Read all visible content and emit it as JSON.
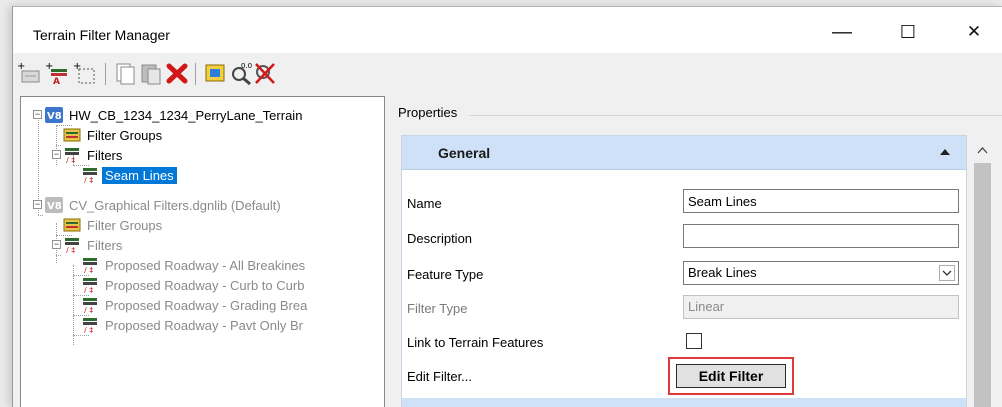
{
  "window": {
    "title": "Terrain Filter Manager"
  },
  "controls": {
    "minimize": "—",
    "maximize": "☐",
    "close": "✕"
  },
  "toolbar": {
    "buttons": [
      "new-terrain-icon",
      "new-filter-icon",
      "new-group-icon",
      "copy-icon",
      "paste-icon",
      "delete-icon",
      "select-icon",
      "preview-icon",
      "clear-icon"
    ]
  },
  "tree": {
    "root1": "HW_CB_1234_1234_PerryLane_Terrain",
    "root1_filter_groups": "Filter Groups",
    "root1_filters": "Filters",
    "root1_seam_lines": "Seam Lines",
    "root2": "CV_Graphical Filters.dgnlib (Default)",
    "root2_filter_groups": "Filter Groups",
    "root2_filters": "Filters",
    "items": [
      "Proposed Roadway - All Breakines",
      "Proposed Roadway - Curb to Curb",
      "Proposed Roadway - Grading Brea",
      "Proposed Roadway - Pavt Only Br"
    ]
  },
  "properties": {
    "header": "Properties",
    "group_title": "General",
    "name_label": "Name",
    "name_value": "Seam Lines",
    "description_label": "Description",
    "description_value": "",
    "feature_type_label": "Feature Type",
    "feature_type_value": "Break Lines",
    "filter_type_label": "Filter Type",
    "filter_type_value": "Linear",
    "link_label": "Link to Terrain Features",
    "link_checked": false,
    "edit_filter_label": "Edit Filter...",
    "edit_filter_button": "Edit Filter"
  },
  "colors": {
    "selection": "#0078d7",
    "highlight_border": "#e0393b",
    "group_header": "#cfe1f6"
  }
}
